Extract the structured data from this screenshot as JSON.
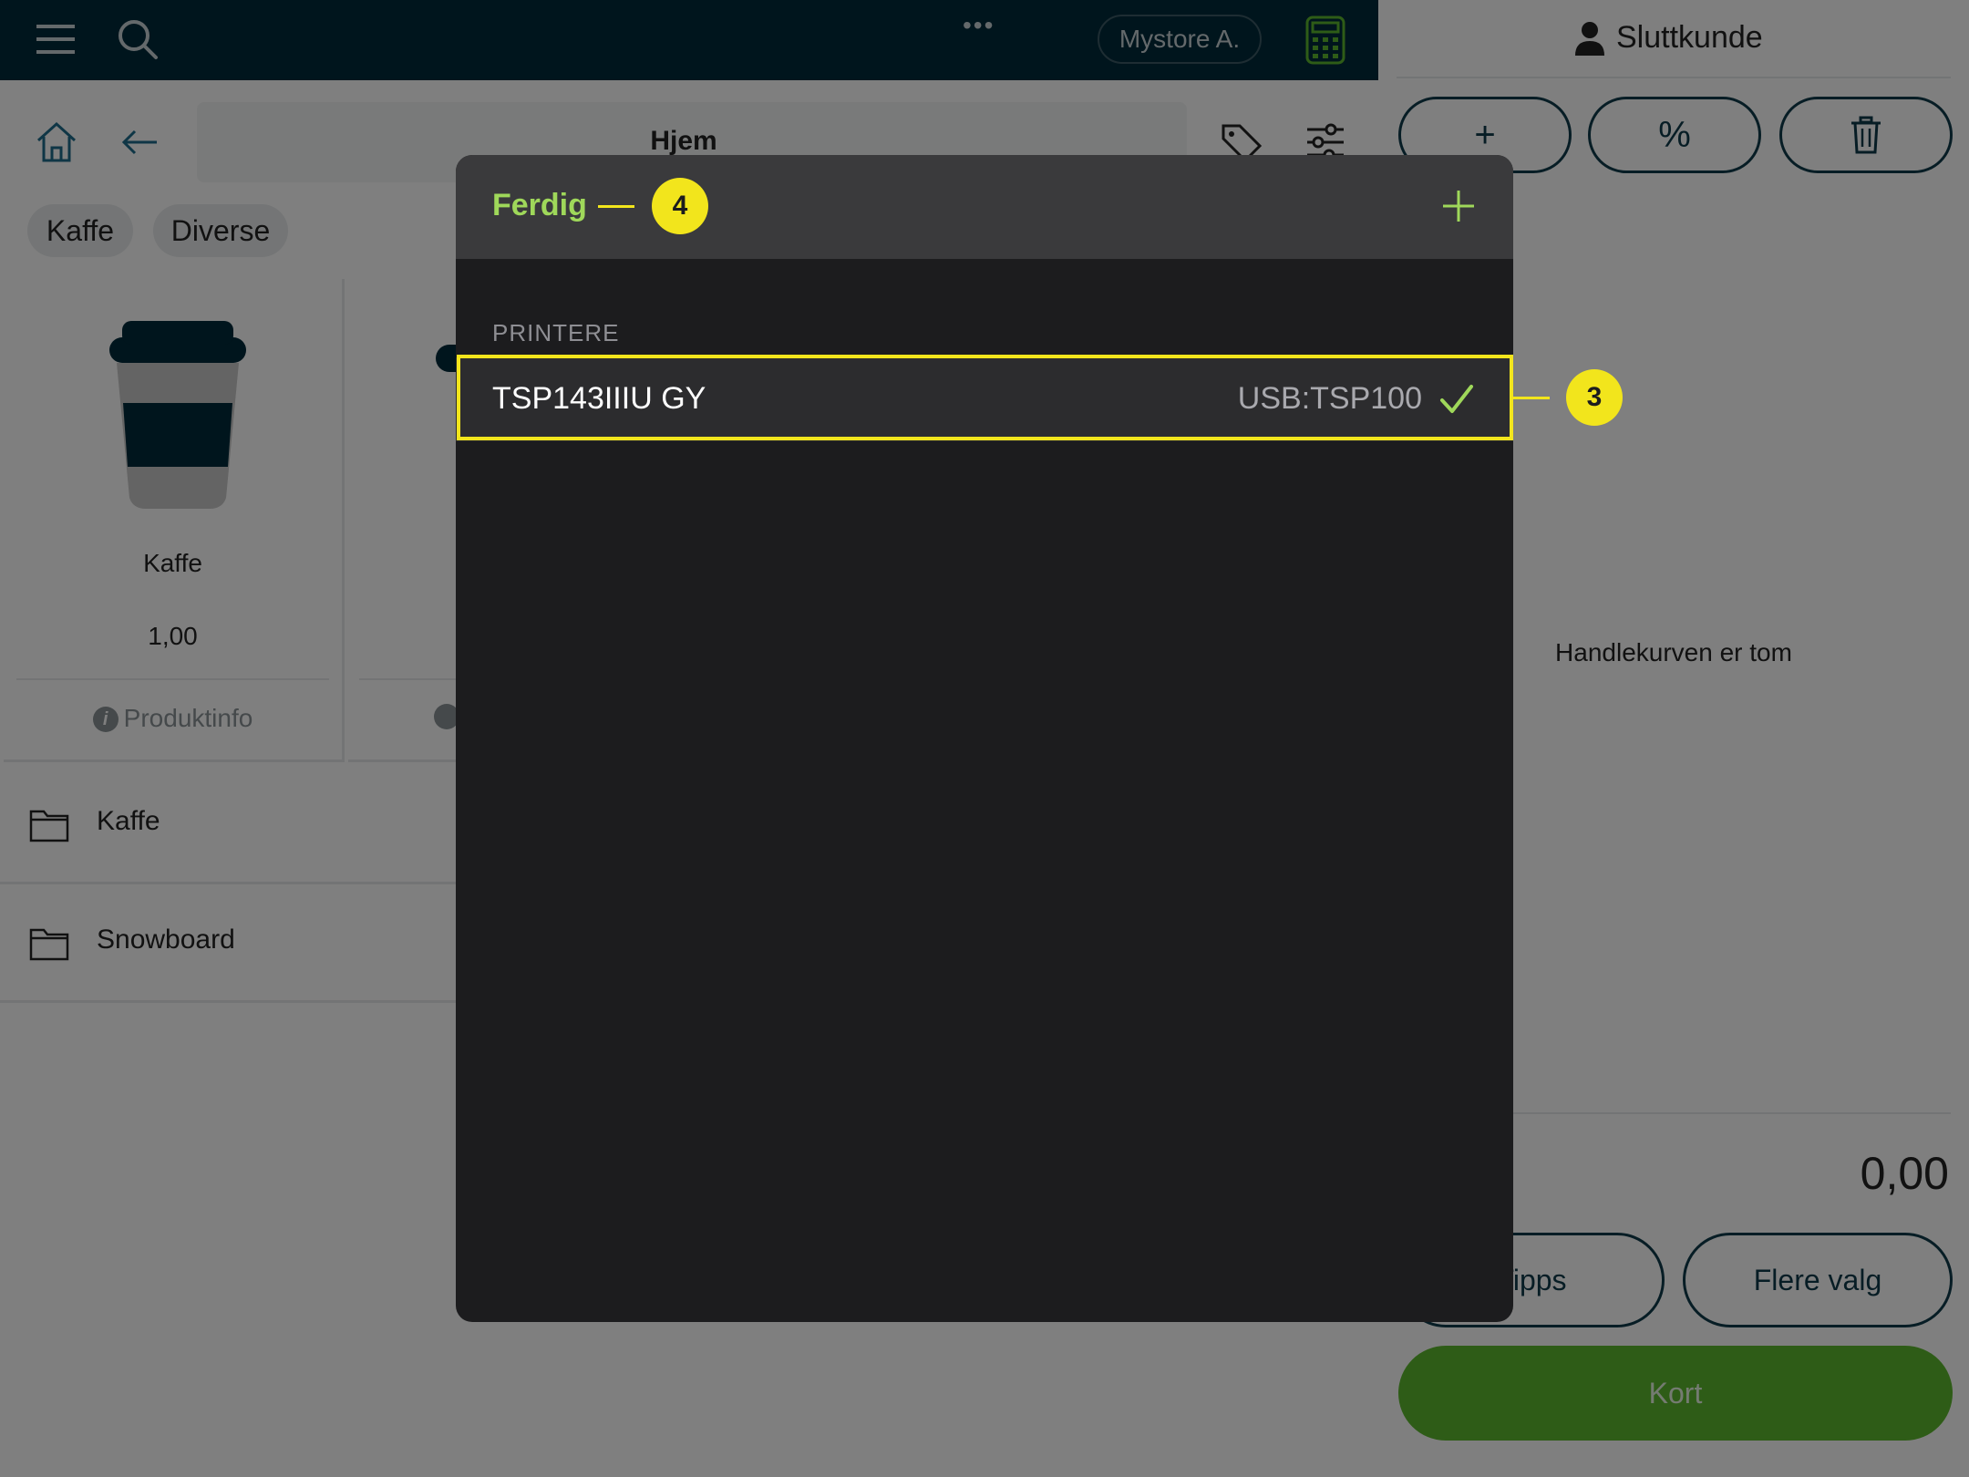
{
  "topbar": {
    "menu_icon": "hamburger-menu-icon",
    "search_icon": "search-icon",
    "more_icon": "more-dots-icon",
    "more_label": "•••",
    "store_label": "Mystore A.",
    "calculator_icon": "calculator-icon"
  },
  "navbar": {
    "home_icon": "home-icon",
    "back_icon": "back-arrow-icon",
    "breadcrumb": "Hjem",
    "tag_icon": "tag-icon",
    "filter_icon": "filter-sliders-icon"
  },
  "categories": [
    {
      "label": "Kaffe"
    },
    {
      "label": "Diverse"
    }
  ],
  "products": [
    {
      "name": "Kaffe",
      "price": "1,00",
      "info_label": "Produktinfo"
    }
  ],
  "folders": [
    {
      "label": "Kaffe"
    },
    {
      "label": "Snowboard"
    }
  ],
  "cart": {
    "customer_label": "Sluttkunde",
    "add_label": "+",
    "discount_label": "%",
    "empty_text": "Handlekurven er tom",
    "total": "0,00",
    "tips_label": "Tipps",
    "more_options_label": "Flere valg",
    "pay_card_label": "Kort"
  },
  "modal": {
    "done_label": "Ferdig",
    "add_icon": "plus-icon",
    "section_label": "PRINTERE",
    "printers": [
      {
        "name": "TSP143IIIU GY",
        "port": "USB:TSP100",
        "selected": true
      }
    ]
  },
  "annotations": [
    {
      "number": "4"
    },
    {
      "number": "3"
    }
  ],
  "colors": {
    "topbar_bg": "#012a3a",
    "accent_green": "#9fd85a",
    "pay_button": "#5db82e",
    "highlight_yellow": "#f2e51c",
    "modal_bg": "#1c1c1e"
  }
}
